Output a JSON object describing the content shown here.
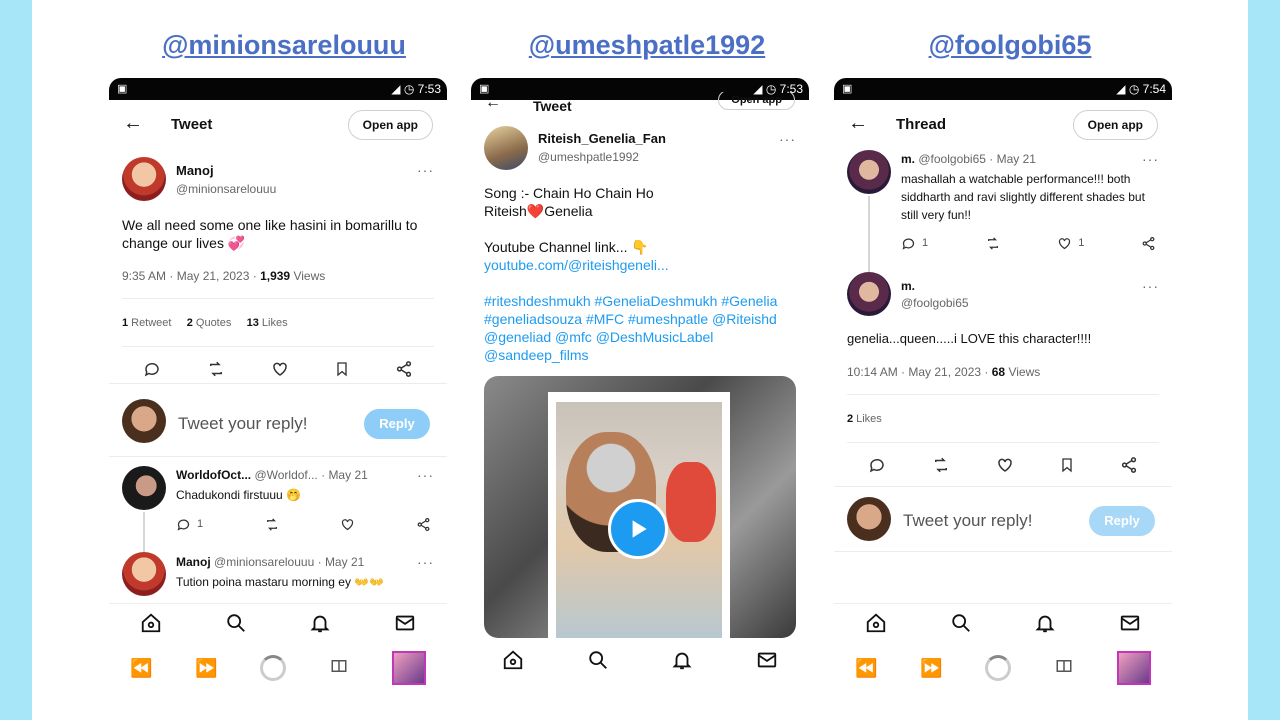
{
  "handles": [
    "@minionsarelouuu",
    "@umeshpatle1992",
    "@foolgobi65"
  ],
  "phone1": {
    "status_time": "7:53",
    "title": "Tweet",
    "open_app": "Open app",
    "main": {
      "name": "Manoj",
      "username": "@minionsarelouuu",
      "text": "We all need some one like hasini in bomarillu to change our lives 💞",
      "time": "9:35 AM · May 21, 2023 · ",
      "views_count": "1,939",
      "views_label": " Views",
      "retweets_count": "1",
      "retweets_label": "Retweet",
      "quotes_count": "2",
      "quotes_label": "Quotes",
      "likes_count": "13",
      "likes_label": "Likes"
    },
    "reply_placeholder": "Tweet your reply!",
    "reply_button": "Reply",
    "replies": [
      {
        "name": "WorldofOct...",
        "handle": "@Worldof...",
        "date": "· May 21",
        "text": "Chadukondi firstuuu 🤭",
        "reply_count": "1"
      },
      {
        "name": "Manoj",
        "handle": "@minionsarelouuu",
        "date": "· May 21",
        "text": "Tution poina mastaru morning ey 👐👐"
      }
    ]
  },
  "phone2": {
    "status_time": "7:53",
    "title": "Tweet",
    "open_app": "Open app",
    "name": "Riteish_Genelia_Fan",
    "username": "@umeshpatle1992",
    "line1": "Song :- Chain Ho Chain Ho",
    "line2a": "Riteish",
    "heart": "❤️",
    "line2b": "Genelia",
    "line3": "Youtube Channel link... 👇",
    "link": "youtube.com/@riteishgeneli...",
    "hashtags": "#riteshdeshmukh #GeneliaDeshmukh #Genelia #geneliadsouza #MFC #umeshpatle @Riteishd @geneliad @mfc @DeshMusicLabel @sandeep_films"
  },
  "phone3": {
    "status_time": "7:54",
    "title": "Thread",
    "open_app": "Open app",
    "parent": {
      "name": "m.",
      "handle": "@foolgobi65",
      "date": "· May 21",
      "text": "mashallah a watchable performance!!! both siddharth and ravi slightly different shades but still very fun!!",
      "reply_count": "1",
      "like_count": "1"
    },
    "main": {
      "name": "m.",
      "username": "@foolgobi65",
      "text": "genelia...queen.....i LOVE this character!!!!",
      "time": "10:14 AM · May 21, 2023 · ",
      "views_count": "68",
      "views_label": " Views",
      "likes_count": "2",
      "likes_label": "Likes"
    },
    "reply_placeholder": "Tweet your reply!",
    "reply_button": "Reply"
  }
}
